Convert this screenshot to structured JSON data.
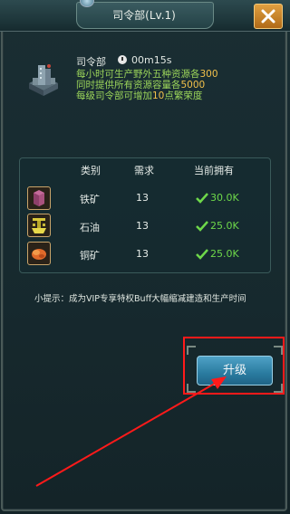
{
  "window": {
    "title": "司令部(Lv.1)"
  },
  "building": {
    "name": "司令部",
    "time": "00m15s",
    "desc_lines": [
      {
        "pre": "每小时可生产野外五种资源各",
        "num": "300",
        "post": ""
      },
      {
        "pre": "同时提供所有资源容量各",
        "num": "5000",
        "post": ""
      },
      {
        "pre": "每级司令部可增加",
        "num": "10",
        "post": "点繁荣度"
      }
    ]
  },
  "table": {
    "headers": {
      "category": "类别",
      "required": "需求",
      "owned": "当前拥有"
    },
    "rows": [
      {
        "icon": "iron-ore-icon",
        "name": "铁矿",
        "required": "13",
        "owned": "30.0K"
      },
      {
        "icon": "oil-icon",
        "name": "石油",
        "required": "13",
        "owned": "25.0K"
      },
      {
        "icon": "copper-ore-icon",
        "name": "铜矿",
        "required": "13",
        "owned": "25.0K"
      }
    ]
  },
  "tip": "小提示：成为VIP专享特权Buff大幅缩减建造和生产时间",
  "upgrade_label": "升级",
  "colors": {
    "accent_green": "#9bd45a",
    "number_gold": "#f2c04a",
    "owned_green": "#6ed84a",
    "annotation_red": "#ff1a1a"
  }
}
